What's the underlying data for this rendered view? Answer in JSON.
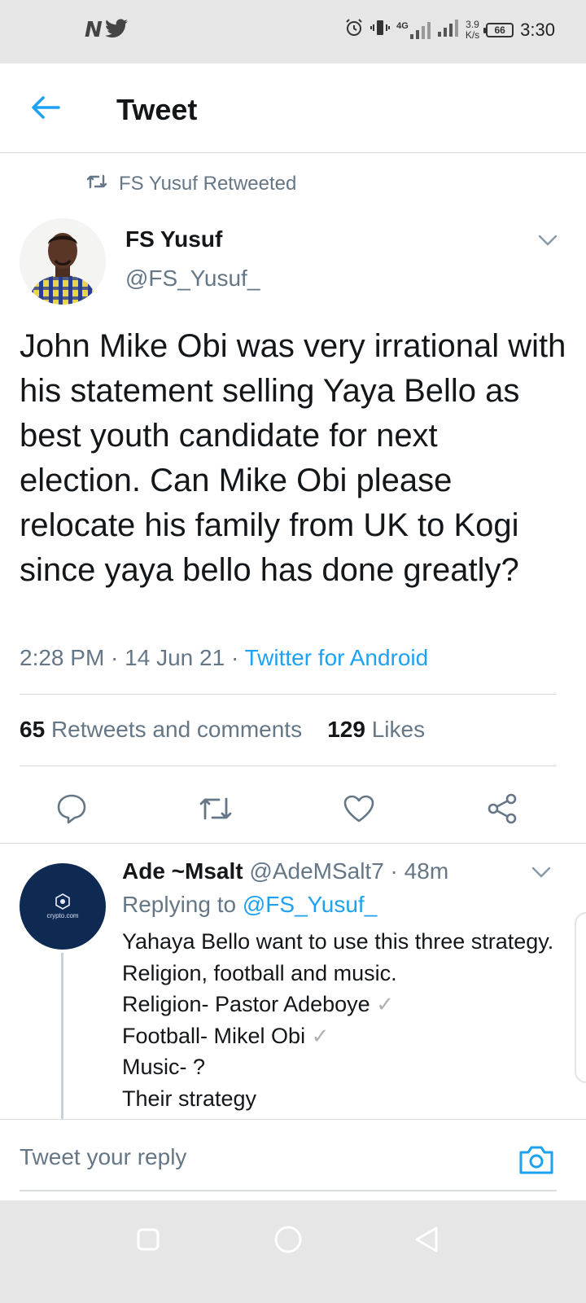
{
  "status_bar": {
    "carrier_logo": "N",
    "social_icon": "twitter-bird-icon",
    "network": "4G",
    "speed_value": "3.9",
    "speed_unit": "K/s",
    "battery": "66",
    "time": "3:30"
  },
  "header": {
    "title": "Tweet"
  },
  "tweet": {
    "retweeted_by": "FS Yusuf Retweeted",
    "author_name": "FS Yusuf",
    "author_handle": "@FS_Yusuf_",
    "text": "John Mike Obi was very irrational with his statement selling Yaya Bello as best youth candidate for next election. Can Mike Obi please relocate his family from UK to Kogi since yaya bello has done greatly?",
    "time": "2:28 PM",
    "date": "14 Jun 21",
    "source": "Twitter for Android",
    "sep": " · ",
    "retweets_count": "65",
    "retweets_label": "Retweets and comments",
    "likes_count": "129",
    "likes_label": "Likes"
  },
  "reply": {
    "avatar_text": "crypto.com",
    "author_name": "Ade ~Msalt",
    "author_handle": "@AdeMSalt7",
    "age": "48m",
    "replying_prefix": "Replying to",
    "replying_to": "@FS_Yusuf_",
    "lines": [
      "Yahaya Bello want to use this three strategy. Religion, football and music.",
      "Religion- Pastor Adeboye",
      "Football- Mikel Obi",
      "Music- ?",
      "Their strategy"
    ],
    "check": "✓"
  },
  "composer": {
    "placeholder": "Tweet your reply"
  },
  "colors": {
    "accent": "#1da1f2",
    "secondary_text": "#657786",
    "primary_text": "#14171a",
    "divider": "#d9dde1"
  }
}
